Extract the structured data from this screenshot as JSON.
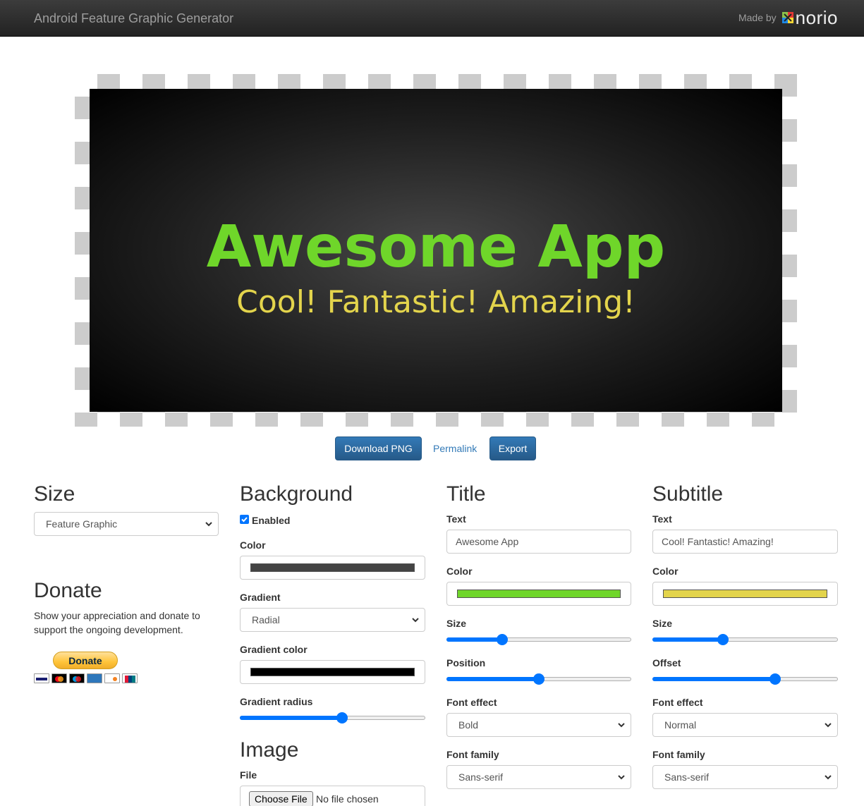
{
  "navbar": {
    "brand": "Android Feature Graphic Generator",
    "made_by": "Made by",
    "logo_text": "norio"
  },
  "preview": {
    "title": "Awesome App",
    "subtitle": "Cool! Fantastic! Amazing!",
    "title_color": "#6fd62a",
    "subtitle_color": "#e3d44c"
  },
  "actions": {
    "download": "Download PNG",
    "permalink": "Permalink",
    "export": "Export"
  },
  "size": {
    "heading": "Size",
    "selected": "Feature Graphic"
  },
  "donate": {
    "heading": "Donate",
    "text": "Show your appreciation and donate to support the ongoing development.",
    "button": "Donate"
  },
  "background": {
    "heading": "Background",
    "enabled_label": "Enabled",
    "enabled": true,
    "color_label": "Color",
    "color": "#444444",
    "gradient_label": "Gradient",
    "gradient_selected": "Radial",
    "gradient_color_label": "Gradient color",
    "gradient_color": "#000000",
    "gradient_radius_label": "Gradient radius",
    "gradient_radius": 0.55
  },
  "image": {
    "heading": "Image",
    "file_label": "File",
    "choose_button": "Choose File",
    "file_status": "No file chosen"
  },
  "title_panel": {
    "heading": "Title",
    "text_label": "Text",
    "text_value": "Awesome App",
    "color_label": "Color",
    "color": "#6fd62a",
    "size_label": "Size",
    "size": 0.3,
    "position_label": "Position",
    "position": 0.5,
    "font_effect_label": "Font effect",
    "font_effect": "Bold",
    "font_family_label": "Font family",
    "font_family": "Sans-serif"
  },
  "subtitle_panel": {
    "heading": "Subtitle",
    "text_label": "Text",
    "text_value": "Cool! Fantastic! Amazing!",
    "color_label": "Color",
    "color": "#e3d44c",
    "size_label": "Size",
    "size": 0.38,
    "offset_label": "Offset",
    "offset": 0.66,
    "font_effect_label": "Font effect",
    "font_effect": "Normal",
    "font_family_label": "Font family",
    "font_family": "Sans-serif"
  }
}
